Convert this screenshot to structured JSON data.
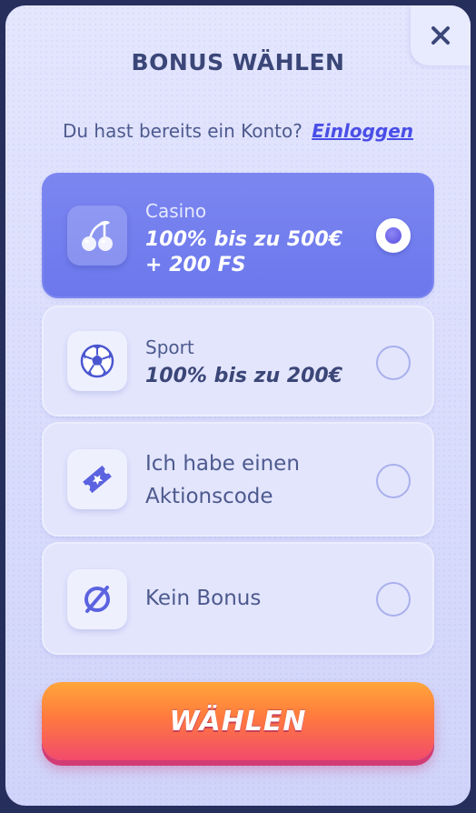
{
  "dialog": {
    "title": "BONUS WÄHLEN",
    "close_icon": "close-icon",
    "login_prompt": "Du hast bereits ein Konto?",
    "login_link": "Einloggen"
  },
  "options": [
    {
      "icon": "cherries-icon",
      "label": "Casino",
      "value_line1": "100% bis zu 500€",
      "value_line2": "+ 200 FS",
      "selected": true
    },
    {
      "icon": "soccer-ball-icon",
      "label": "Sport",
      "value_line1": "100% bis zu 200€",
      "selected": false
    },
    {
      "icon": "ticket-icon",
      "line1": "Ich habe einen",
      "line2": "Aktionscode",
      "selected": false
    },
    {
      "icon": "no-bonus-icon",
      "line1": "Kein Bonus",
      "selected": false
    }
  ],
  "submit_label": "WÄHLEN",
  "colors": {
    "accent": "#6c78ec",
    "text_dark": "#3b4678",
    "link": "#4a4ee6",
    "cta_top": "#ffa63a",
    "cta_bottom": "#f24a6c"
  }
}
